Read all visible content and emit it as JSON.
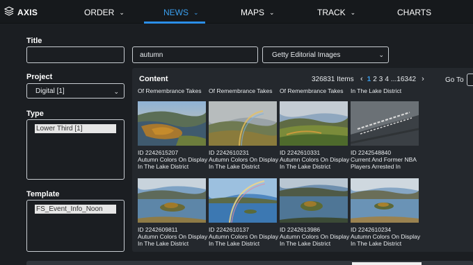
{
  "app": {
    "brand": "AXIS"
  },
  "nav": [
    {
      "label": "ORDER",
      "active": false
    },
    {
      "label": "NEWS",
      "active": true
    },
    {
      "label": "MAPS",
      "active": false
    },
    {
      "label": "TRACK",
      "active": false
    },
    {
      "label": "CHARTS",
      "active": false
    }
  ],
  "form": {
    "title_label": "Title",
    "title_value": "",
    "project_label": "Project",
    "project_value": "Digital [1]",
    "type_label": "Type",
    "type_value": "Lower Third [1]",
    "template_label": "Template",
    "template_value": "FS_Event_Info_Noon"
  },
  "search": {
    "query": "autumn",
    "source": "Getty Editorial Images"
  },
  "content": {
    "title": "Content",
    "items_count": "326831 Items",
    "pages": [
      "1",
      "2",
      "3",
      "4",
      "...",
      "16342"
    ],
    "current_page": "1",
    "prev_icon": "chevron-left-icon",
    "next_icon": "chevron-right-icon",
    "goto_label": "Go To",
    "goto_value": ""
  },
  "cutoff_captions": [
    "Of Remembrance Takes",
    "Of Remembrance Takes",
    "Of Remembrance Takes",
    "In The Lake District"
  ],
  "results": [
    {
      "id": "ID 2242615207",
      "line1": "Autumn Colors On Display",
      "line2": "In The Lake District"
    },
    {
      "id": "ID 2242610231",
      "line1": "Autumn Colors On Display",
      "line2": "In The Lake District"
    },
    {
      "id": "ID 2242610331",
      "line1": "Autumn Colors On Display",
      "line2": "In The Lake District"
    },
    {
      "id": "ID 2242548840",
      "line1": "Current And Former NBA",
      "line2": "Players Arrested In"
    },
    {
      "id": "ID 2242609811",
      "line1": "Autumn Colors On Display",
      "line2": "In The Lake District"
    },
    {
      "id": "ID 2242610137",
      "line1": "Autumn Colors On Display",
      "line2": "In The Lake District"
    },
    {
      "id": "ID 2242613986",
      "line1": "Autumn Colors On Display",
      "line2": "In The Lake District"
    },
    {
      "id": "ID 2242610234",
      "line1": "Autumn Colors On Display",
      "line2": "In The Lake District"
    }
  ],
  "colors": {
    "accent": "#3aa0f0",
    "background": "#1b1e22",
    "panel": "#24282d"
  }
}
